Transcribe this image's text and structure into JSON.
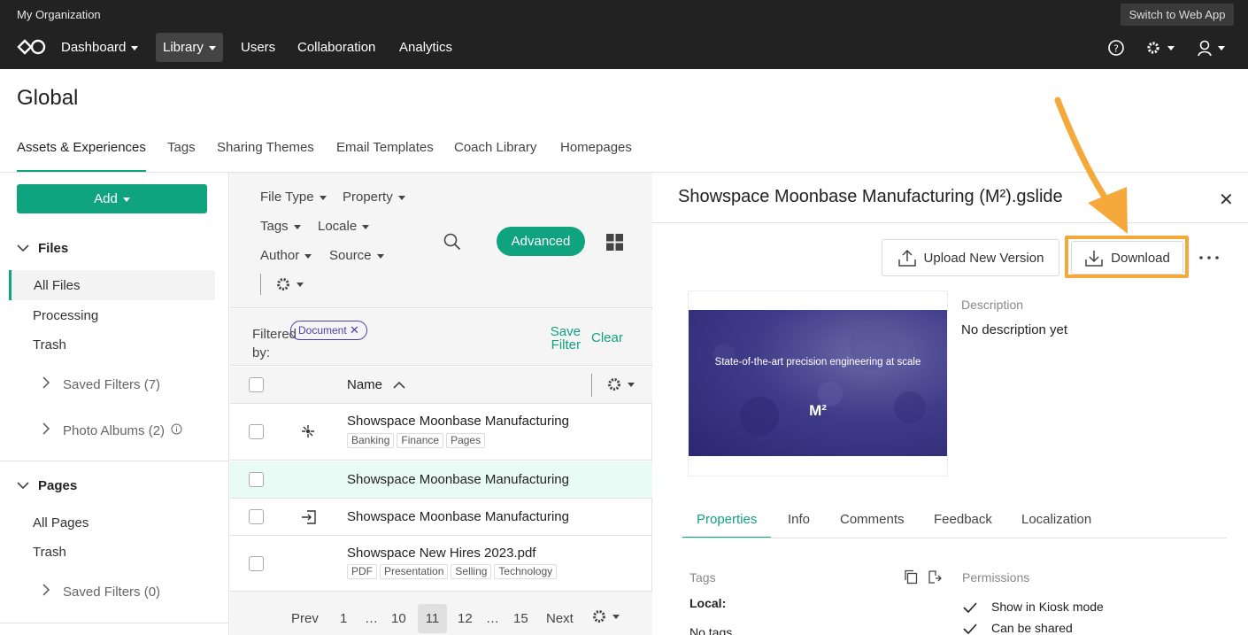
{
  "topbar": {
    "org": "My Organization",
    "switch_label": "Switch to Web App",
    "nav": [
      "Dashboard",
      "Library",
      "Users",
      "Collaboration",
      "Analytics"
    ]
  },
  "header": {
    "title": "Global",
    "tabs": [
      "Assets & Experiences",
      "Tags",
      "Sharing Themes",
      "Email Templates",
      "Coach Library",
      "Homepages"
    ]
  },
  "sidebar": {
    "add_label": "Add",
    "files_label": "Files",
    "files_items": [
      "All Files",
      "Processing",
      "Trash"
    ],
    "saved_filters": "Saved Filters (7)",
    "photo_albums": "Photo Albums (2)",
    "pages_label": "Pages",
    "pages_items": [
      "All Pages",
      "Trash"
    ],
    "pages_saved_filters": "Saved Filters (0)"
  },
  "filters": {
    "file_type": "File Type",
    "property": "Property",
    "tags": "Tags",
    "locale": "Locale",
    "author": "Author",
    "source": "Source",
    "advanced": "Advanced",
    "filtered_by": "Filtered by:",
    "chip": "Document",
    "save_filter": "Save Filter",
    "clear": "Clear"
  },
  "table": {
    "name_header": "Name",
    "rows": [
      {
        "name": "Showspace Moonbase Manufacturing",
        "tags": [
          "Banking",
          "Finance",
          "Pages"
        ]
      },
      {
        "name": "Showspace Moonbase Manufacturing",
        "tags": []
      },
      {
        "name": "Showspace Moonbase Manufacturing",
        "tags": []
      },
      {
        "name": "Showspace New Hires 2023.pdf",
        "tags": [
          "PDF",
          "Presentation",
          "Selling",
          "Technology"
        ]
      }
    ]
  },
  "pager": {
    "prev": "Prev",
    "pages": [
      "1",
      "…",
      "10",
      "11",
      "12",
      "…",
      "15"
    ],
    "current": "11",
    "next": "Next"
  },
  "detail": {
    "title": "Showspace Moonbase Manufacturing (M²).gslide",
    "upload_label": "Upload New Version",
    "download_label": "Download",
    "thumb_caption": "State-of-the-art precision engineering at scale",
    "thumb_logo": "M²",
    "description_label": "Description",
    "description_text": "No description yet",
    "tabs": [
      "Properties",
      "Info",
      "Comments",
      "Feedback",
      "Localization"
    ],
    "tags_label": "Tags",
    "local_label": "Local:",
    "no_tags": "No tags",
    "permissions_label": "Permissions",
    "permissions": [
      "Show in Kiosk mode",
      "Can be shared"
    ]
  },
  "colors": {
    "accent": "#0fa37f",
    "highlight": "#f5a93b",
    "topbar": "#222222",
    "chip": "#4b3fa8"
  }
}
